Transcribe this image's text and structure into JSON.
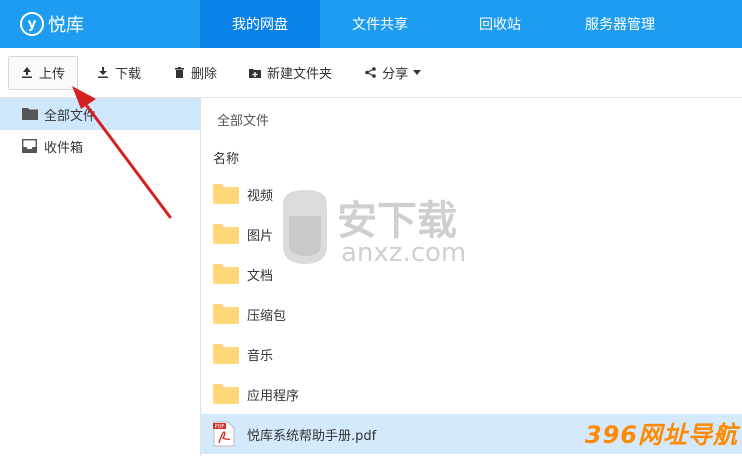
{
  "brand": {
    "logo_glyph": "y",
    "name": "悦库"
  },
  "nav": {
    "items": [
      {
        "label": "我的网盘",
        "active": true
      },
      {
        "label": "文件共享",
        "active": false
      },
      {
        "label": "回收站",
        "active": false
      },
      {
        "label": "服务器管理",
        "active": false
      }
    ]
  },
  "toolbar": {
    "upload": "上传",
    "download": "下载",
    "delete": "删除",
    "new_folder": "新建文件夹",
    "share": "分享"
  },
  "sidebar": {
    "items": [
      {
        "label": "全部文件",
        "icon": "folder-icon",
        "active": true
      },
      {
        "label": "收件箱",
        "icon": "inbox-icon",
        "active": false
      }
    ]
  },
  "main": {
    "breadcrumb": "全部文件",
    "column_name": "名称",
    "files": [
      {
        "name": "视频",
        "type": "folder"
      },
      {
        "name": "图片",
        "type": "folder"
      },
      {
        "name": "文档",
        "type": "folder"
      },
      {
        "name": "压缩包",
        "type": "folder"
      },
      {
        "name": "音乐",
        "type": "folder"
      },
      {
        "name": "应用程序",
        "type": "folder"
      },
      {
        "name": "悦库系统帮助手册.pdf",
        "type": "pdf",
        "selected": true
      }
    ]
  },
  "watermark": {
    "text": "安下载",
    "domain": "anxz.com",
    "corner_text": "396网址导航"
  },
  "colors": {
    "primary": "#1e9cf2",
    "nav_active": "#0a82e8",
    "selection": "#d4e9fb",
    "folder": "#ffd77a",
    "arrow": "#d42020"
  }
}
